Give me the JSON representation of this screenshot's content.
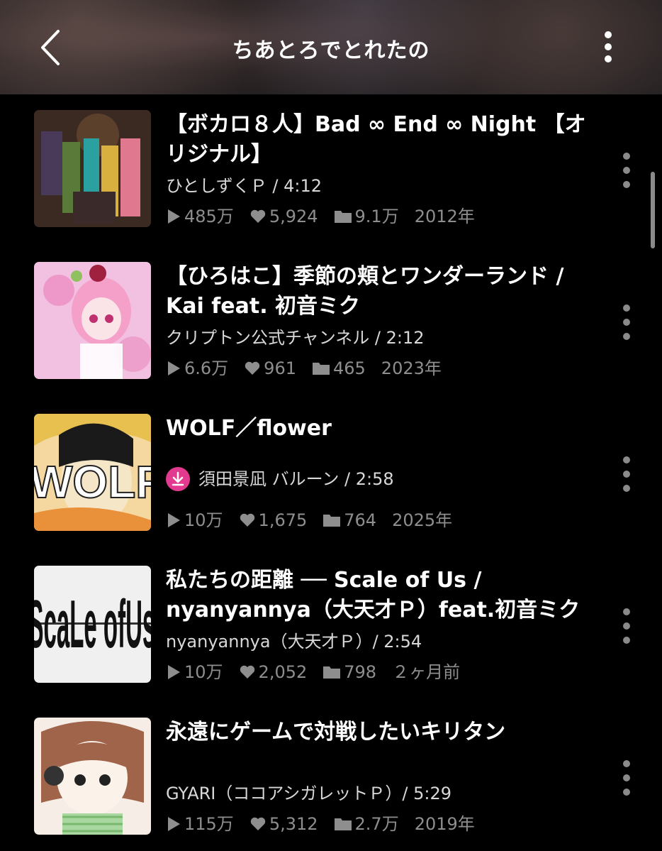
{
  "header": {
    "title": "ちあとろでとれたの"
  },
  "items": [
    {
      "title": "【ボカロ８人】Bad ∞ End ∞ Night 【オリジナル】",
      "artist": "ひとしずくＰ / 4:12",
      "plays": "485万",
      "likes": "5,924",
      "mylists": "9.1万",
      "date": "2012年",
      "downloaded": false
    },
    {
      "title": "【ひろはこ】季節の頬とワンダーランド / Kai feat. 初音ミク",
      "artist": "クリプトン公式チャンネル / 2:12",
      "plays": "6.6万",
      "likes": "961",
      "mylists": "465",
      "date": "2023年",
      "downloaded": false
    },
    {
      "title": "WOLF／flower",
      "artist": "須田景凪 バルーン / 2:58",
      "plays": "10万",
      "likes": "1,675",
      "mylists": "764",
      "date": "2025年",
      "downloaded": true
    },
    {
      "title": "私たちの距離 ── Scale of Us / nyanyannya（大天才Ｐ）feat.初音ミク",
      "artist": "nyanyannya（大天才Ｐ）/ 2:54",
      "plays": "10万",
      "likes": "2,052",
      "mylists": "798",
      "date": "２ヶ月前",
      "downloaded": false
    },
    {
      "title": "永遠にゲームで対戦したいキリタン",
      "artist": "GYARI（ココアシガレットＰ）/ 5:29",
      "plays": "115万",
      "likes": "5,312",
      "mylists": "2.7万",
      "date": "2019年",
      "downloaded": false
    }
  ],
  "thumbs": {
    "wolf_text": "WOLF",
    "scale_text": "ScaLe ofUs"
  }
}
